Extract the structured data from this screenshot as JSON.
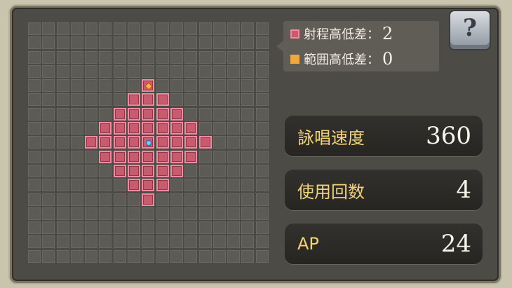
{
  "legend": {
    "range_label": "射程高低差：",
    "range_value": "2",
    "area_label": "範囲高低差：",
    "area_value": "0"
  },
  "help_button": {
    "label": "?"
  },
  "stats": [
    {
      "label": "詠唱速度",
      "value": "360"
    },
    {
      "label": "使用回数",
      "value": "4"
    },
    {
      "label": "AP",
      "value": "24"
    }
  ],
  "grid": {
    "rows": 17,
    "cols": 17,
    "range_rows": [
      "00000000000000000",
      "00000000000000000",
      "00000000000000000",
      "00000000000000000",
      "00000000100000000",
      "00000001110000000",
      "00000011111000000",
      "00000111111100000",
      "00001111111110000",
      "00000111111100000",
      "00000011111000000",
      "00000001110000000",
      "00000000100000000",
      "00000000000000000",
      "00000000000000000",
      "00000000000000000",
      "00000000000000000"
    ],
    "target_cell": [
      4,
      8
    ],
    "origin_cell": [
      8,
      8
    ],
    "colors": {
      "range": "#c95b6e",
      "area": "#f3a83b"
    }
  }
}
